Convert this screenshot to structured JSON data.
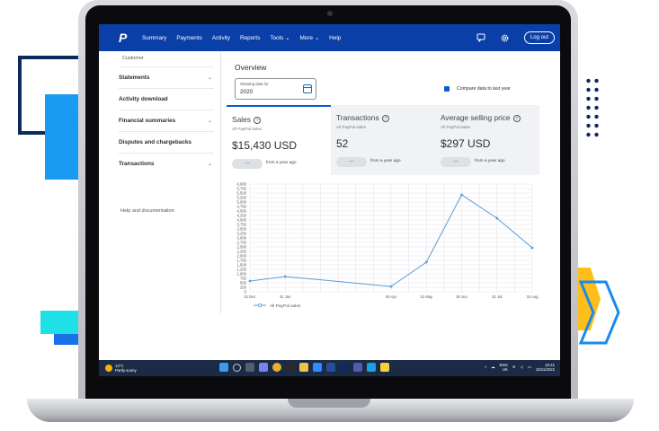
{
  "brand": {
    "logo_letter": "P"
  },
  "topnav": {
    "items": [
      "Summary",
      "Payments",
      "Activity",
      "Reports",
      "Tools",
      "More",
      "Help"
    ],
    "dropdown_arrow": "⌄",
    "logout_label": "Log out",
    "icons": [
      "message-center-icon",
      "gear-icon"
    ]
  },
  "sidebar": {
    "breadcrumb": "Customer",
    "items": [
      {
        "label": "Statements",
        "has_chevron": true
      },
      {
        "label": "Activity download",
        "has_chevron": false
      },
      {
        "label": "Financial summaries",
        "has_chevron": true
      },
      {
        "label": "Disputes and chargebacks",
        "has_chevron": false
      },
      {
        "label": "Transactions",
        "has_chevron": true
      }
    ],
    "chevron": "⌄",
    "help_link": "Help and documentation"
  },
  "overview": {
    "title": "Overview",
    "date_label": "Showing data for",
    "date_value": "2020",
    "compare_label": "Compare data to last year",
    "compare_checked": true
  },
  "kpis": [
    {
      "title": "Sales",
      "subtitle": "All PayPal sales",
      "value": "$15,430 USD",
      "pill": "—",
      "compare": "from a year ago",
      "active": true
    },
    {
      "title": "Transactions",
      "subtitle": "All PayPal sales",
      "value": "52",
      "pill": "—",
      "compare": "from a year ago",
      "active": false
    },
    {
      "title": "Average selling price",
      "subtitle": "All PayPal sales",
      "value": "$297 USD",
      "pill": "—",
      "compare": "from a year ago",
      "active": false
    }
  ],
  "info_glyph": "?",
  "chart_data": {
    "type": "line",
    "x": [
      "31 Dec",
      "31 Jan",
      "30 Apr",
      "31 May",
      "30 Jun",
      "31 Jul",
      "31 Aug"
    ],
    "x_positions": [
      0,
      1,
      4,
      5,
      6,
      7,
      8
    ],
    "y_ticks": [
      "0",
      "250",
      "500",
      "750",
      "1,000",
      "1,250",
      "1,500",
      "1,750",
      "2,000",
      "2,250",
      "2,500",
      "2,750",
      "3,000",
      "3,250",
      "3,500",
      "3,750",
      "4,000",
      "4,250",
      "4,500",
      "4,750",
      "5,000",
      "5,250",
      "5,500",
      "5,750",
      "6,000"
    ],
    "series": [
      {
        "name": "All PayPal sales",
        "values": [
          600,
          850,
          300,
          1650,
          5400,
          4100,
          2450
        ]
      }
    ],
    "ylim": [
      0,
      6000
    ],
    "grid": true,
    "legend": "bottom-left",
    "line_color": "#5b9bd5"
  },
  "taskbar": {
    "weather_temp": "13°C",
    "weather_desc": "Partly sunny",
    "lang_1": "ENG",
    "lang_2": "UK",
    "time": "10:41",
    "date": "10/11/2022"
  }
}
